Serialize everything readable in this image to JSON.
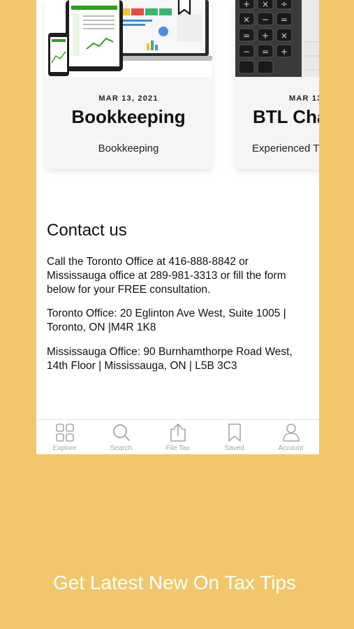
{
  "cards": [
    {
      "date": "MAR 13, 2021",
      "title": "Bookkeeping",
      "subtitle": "Bookkeeping"
    },
    {
      "date": "MAR 13",
      "title": "BTL Cha",
      "subtitle": "Experienced T"
    }
  ],
  "contact": {
    "heading": "Contact us",
    "intro": "Call the Toronto Office at 416-888-8842 or Mississauga office at 289-981-3313 or fill the form below for your FREE consultation.",
    "toronto": "Toronto Office: 20 Eglinton Ave West, Suite 1005 | Toronto, ON |M4R 1K8",
    "mississauga": "Mississauga Office: 90 Burnhamthorpe Road West, 14th Floor | Mississauga, ON | L5B 3C3"
  },
  "tabs": [
    {
      "label": "Explore",
      "icon": "grid-icon"
    },
    {
      "label": "Search",
      "icon": "search-icon"
    },
    {
      "label": "File Tax",
      "icon": "upload-icon"
    },
    {
      "label": "Saved",
      "icon": "bookmark-icon"
    },
    {
      "label": "Account",
      "icon": "person-icon"
    }
  ],
  "colors": {
    "background": "#f2c76b",
    "tab_inactive": "#a6a6a6"
  },
  "tagline": "Get Latest New On Tax Tips"
}
